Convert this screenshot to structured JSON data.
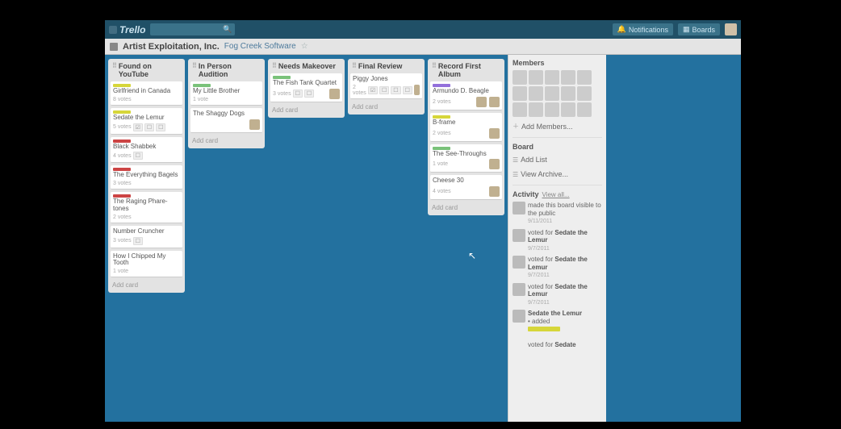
{
  "header": {
    "logo": "Trello",
    "notifications": "Notifications",
    "boards": "Boards"
  },
  "board": {
    "title": "Artist Exploitation, Inc.",
    "org": "Fog Creek Software"
  },
  "lists": [
    {
      "title": "Found on YouTube",
      "cards": [
        {
          "labels": [
            "yellow"
          ],
          "title": "Girlfriend in Canada",
          "votes": "8 votes",
          "badges": []
        },
        {
          "labels": [
            "yellow"
          ],
          "title": "Sedate the Lemur",
          "votes": "5 votes",
          "badges": [
            "☑",
            "☐",
            "☐"
          ]
        },
        {
          "labels": [
            "red"
          ],
          "title": "Black Shabbek",
          "votes": "4 votes",
          "badges": [
            "☐"
          ]
        },
        {
          "labels": [
            "red"
          ],
          "title": "The Everything Bagels",
          "votes": "3 votes",
          "badges": []
        },
        {
          "labels": [
            "red"
          ],
          "title": "The Raging Phare-tones",
          "votes": "2 votes",
          "badges": []
        },
        {
          "labels": [],
          "title": "Number Cruncher",
          "votes": "3 votes",
          "badges": [
            "☐"
          ]
        },
        {
          "labels": [],
          "title": "How I Chipped My Tooth",
          "votes": "1 vote",
          "badges": []
        }
      ],
      "addcard": "Add card"
    },
    {
      "title": "In Person Audition",
      "cards": [
        {
          "labels": [
            "green"
          ],
          "title": "My Little Brother",
          "votes": "1 vote",
          "badges": []
        },
        {
          "labels": [],
          "title": "The Shaggy Dogs",
          "votes": "",
          "badges": [],
          "avatars": 1
        }
      ],
      "addcard": "Add card"
    },
    {
      "title": "Needs Makeover",
      "cards": [
        {
          "labels": [
            "green"
          ],
          "title": "The Fish Tank Quartet",
          "votes": "3 votes",
          "badges": [
            "☐",
            "☐"
          ],
          "avatars": 1
        }
      ],
      "addcard": "Add card"
    },
    {
      "title": "Final Review",
      "cards": [
        {
          "labels": [],
          "title": "Piggy Jones",
          "votes": "2 votes",
          "badges": [
            "☑",
            "☐",
            "☐",
            "☐"
          ],
          "avatars": 1
        }
      ],
      "addcard": "Add card"
    },
    {
      "title": "Record First Album",
      "cards": [
        {
          "labels": [
            "purple"
          ],
          "title": "Armundo D. Beagle",
          "votes": "2 votes",
          "badges": [],
          "avatars": 2
        },
        {
          "labels": [
            "yellow"
          ],
          "title": "B-frame",
          "votes": "2 votes",
          "badges": [],
          "avatars": 1
        },
        {
          "labels": [
            "green"
          ],
          "title": "The See-Throughs",
          "votes": "1 vote",
          "badges": [],
          "avatars": 1
        },
        {
          "labels": [],
          "title": "Cheese 30",
          "votes": "4 votes",
          "badges": [],
          "avatars": 1
        }
      ],
      "addcard": "Add card"
    }
  ],
  "sidebar": {
    "members_h": "Members",
    "member_count": 15,
    "add_members": "Add Members...",
    "board_h": "Board",
    "add_list": "Add List",
    "view_archive": "View Archive...",
    "activity_h": "Activity",
    "view_all": "View all...",
    "activity": [
      {
        "text": "made this board visible to the public",
        "date": "9/11/2011"
      },
      {
        "text": "voted for",
        "bold": "Sedate the Lemur",
        "date": "9/7/2011"
      },
      {
        "text": "voted for",
        "bold": "Sedate the Lemur",
        "date": "9/7/2011"
      },
      {
        "text": "voted for",
        "bold": "Sedate the Lemur",
        "date": "9/7/2011"
      },
      {
        "bold2": "Sedate the Lemur",
        "tag": true,
        "text2": "added",
        "text3": "voted for",
        "bold3": "Sedate"
      }
    ]
  }
}
